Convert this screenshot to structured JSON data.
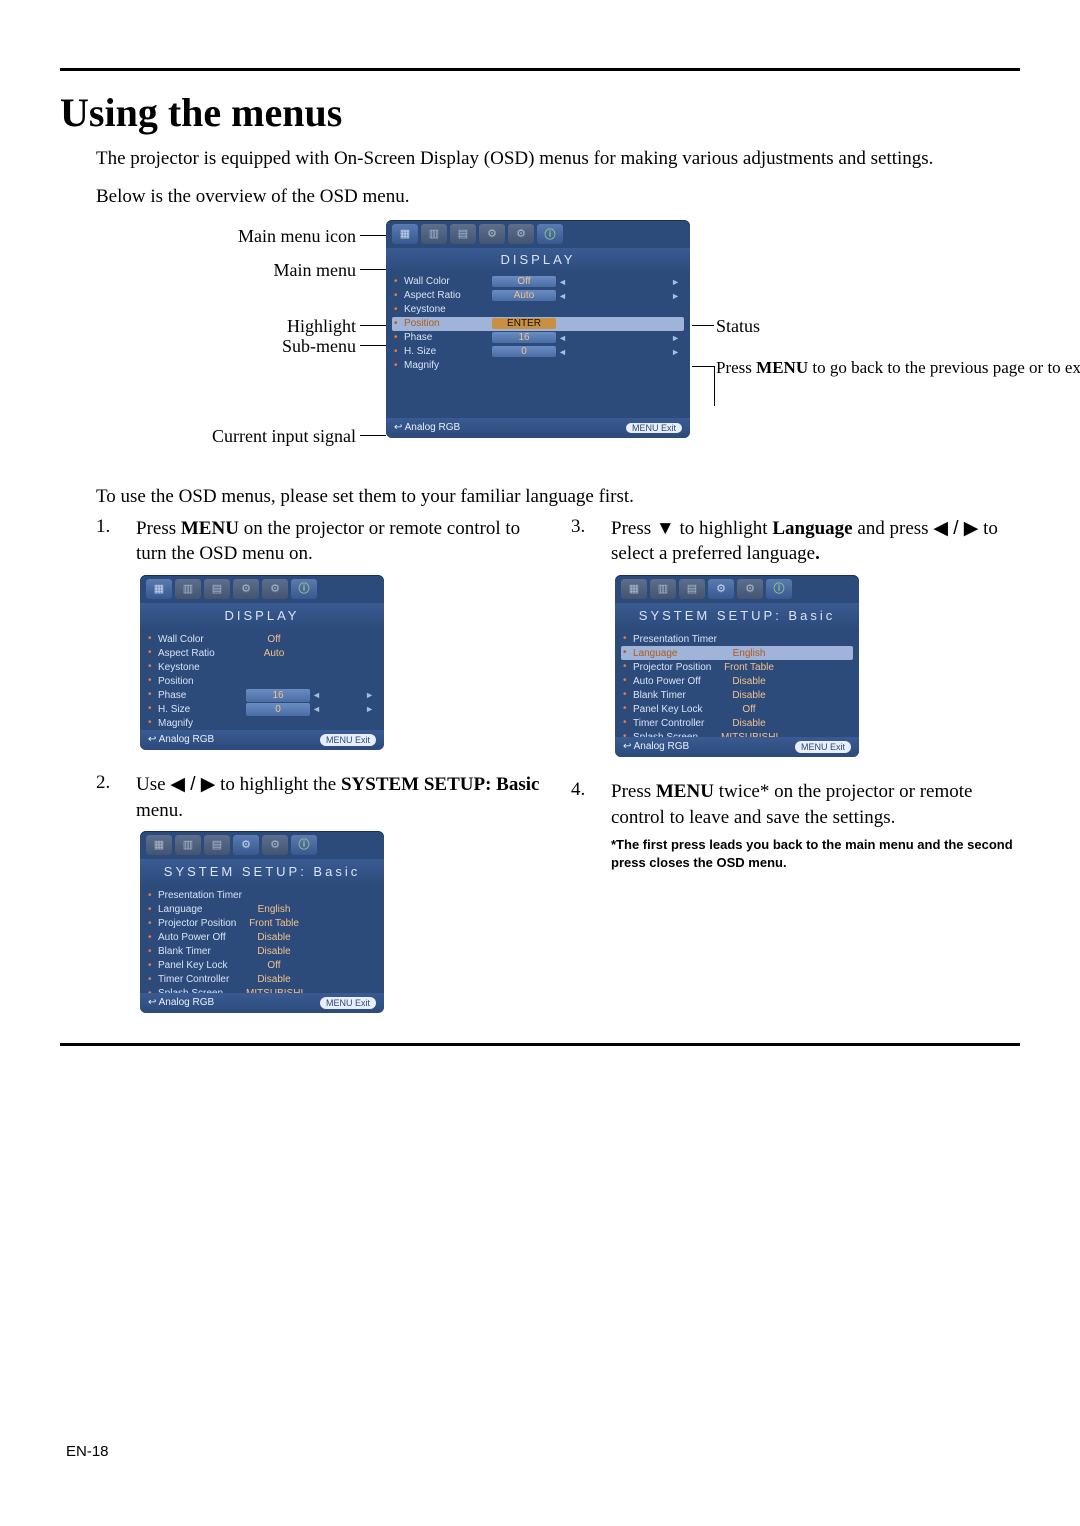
{
  "heading": "Using the menus",
  "intro": "The projector is equipped with On-Screen Display (OSD) menus for making various adjustments and settings.",
  "intro2": "Below is the overview of the OSD menu.",
  "labels": {
    "main_menu_icon": "Main menu icon",
    "main_menu": "Main menu",
    "highlight": "Highlight",
    "sub_menu": "Sub-menu",
    "current_input_signal": "Current input signal",
    "status": "Status",
    "press_menu_line1": "Press ",
    "press_menu_bold": "MENU",
    "press_menu_rest": " to go back to the previous page or to exit."
  },
  "osd_display": {
    "title": "DISPLAY",
    "rows": [
      {
        "k": "Wall Color",
        "v": "Off",
        "vbox": true,
        "arrows": true,
        "hl": false
      },
      {
        "k": "Aspect Ratio",
        "v": "Auto",
        "vbox": true,
        "arrows": true,
        "hl": false
      },
      {
        "k": "Keystone",
        "v": "",
        "vbox": false,
        "arrows": false,
        "hl": false
      },
      {
        "k": "Position",
        "v": "ENTER",
        "vbox": true,
        "arrows": false,
        "hl": true,
        "enter": true
      },
      {
        "k": "Phase",
        "v": "16",
        "vbox": true,
        "arrows": true,
        "hl": false
      },
      {
        "k": "H. Size",
        "v": "0",
        "vbox": true,
        "arrows": true,
        "hl": false
      },
      {
        "k": "Magnify",
        "v": "",
        "vbox": false,
        "arrows": false,
        "hl": false
      }
    ],
    "src": "Analog RGB",
    "footer_btn": "MENU Exit"
  },
  "osd_display_step1": {
    "title": "DISPLAY",
    "rows": [
      {
        "k": "Wall Color",
        "v": "Off",
        "vbox": false,
        "arrows": false,
        "hl": false
      },
      {
        "k": "Aspect Ratio",
        "v": "Auto",
        "vbox": false,
        "arrows": false,
        "hl": false
      },
      {
        "k": "Keystone",
        "v": "",
        "vbox": false,
        "arrows": false,
        "hl": false
      },
      {
        "k": "Position",
        "v": "",
        "vbox": false,
        "arrows": false,
        "hl": false
      },
      {
        "k": "Phase",
        "v": "16",
        "vbox": true,
        "arrows": true,
        "hl": false
      },
      {
        "k": "H. Size",
        "v": "0",
        "vbox": true,
        "arrows": true,
        "hl": false
      },
      {
        "k": "Magnify",
        "v": "",
        "vbox": false,
        "arrows": false,
        "hl": false
      }
    ],
    "src": "Analog RGB",
    "footer_btn": "MENU Exit"
  },
  "osd_system_basic": {
    "title": "SYSTEM SETUP: Basic",
    "rows": [
      {
        "k": "Presentation Timer",
        "v": "",
        "hl": false
      },
      {
        "k": "Language",
        "v": "English",
        "hl": false
      },
      {
        "k": "Projector Position",
        "v": "Front Table",
        "hl": false
      },
      {
        "k": "Auto Power Off",
        "v": "Disable",
        "hl": false
      },
      {
        "k": "Blank Timer",
        "v": "Disable",
        "hl": false
      },
      {
        "k": "Panel Key Lock",
        "v": "Off",
        "hl": false
      },
      {
        "k": "Timer Controller",
        "v": "Disable",
        "hl": false
      },
      {
        "k": "Splash Screen",
        "v": "MITSUBISHI",
        "hl": false
      }
    ],
    "src": "Analog RGB",
    "footer_btn": "MENU Exit"
  },
  "osd_system_basic_lang": {
    "title": "SYSTEM SETUP: Basic",
    "rows": [
      {
        "k": "Presentation Timer",
        "v": "",
        "hl": false
      },
      {
        "k": "Language",
        "v": "English",
        "hl": true
      },
      {
        "k": "Projector Position",
        "v": "Front Table",
        "hl": false
      },
      {
        "k": "Auto Power Off",
        "v": "Disable",
        "hl": false
      },
      {
        "k": "Blank Timer",
        "v": "Disable",
        "hl": false
      },
      {
        "k": "Panel Key Lock",
        "v": "Off",
        "hl": false
      },
      {
        "k": "Timer Controller",
        "v": "Disable",
        "hl": false
      },
      {
        "k": "Splash Screen",
        "v": "MITSUBISHI",
        "hl": false
      }
    ],
    "src": "Analog RGB",
    "footer_btn": "MENU Exit"
  },
  "lead2": "To use the OSD menus, please set them to your familiar language first.",
  "steps_left": [
    {
      "num": "1.",
      "t_pre": "Press ",
      "t_bold": "MENU",
      "t_post": " on the projector or remote control to turn the OSD menu on."
    },
    {
      "num": "2.",
      "t_pre": "Use ",
      "arrows_lr": true,
      "t_mid": " to highlight the ",
      "t_bold": "SYSTEM SETUP: Basic",
      "t_post": " menu."
    }
  ],
  "steps_right": [
    {
      "num": "3.",
      "t_pre": "Press ",
      "arrow_down": true,
      "t_mid": " to highlight ",
      "t_bold": "Language",
      "t_and": " and press ",
      "arrows_lr2": true,
      "t_post": " to select a preferred language",
      "t_dot": "."
    },
    {
      "num": "4.",
      "t_pre": "Press ",
      "t_bold": "MENU",
      "t_post": " twice* on the projector or remote control to leave and save the settings."
    }
  ],
  "footnote": "*The first press leads you back to the main menu and the second press closes the OSD menu.",
  "page_footer": "EN-18"
}
